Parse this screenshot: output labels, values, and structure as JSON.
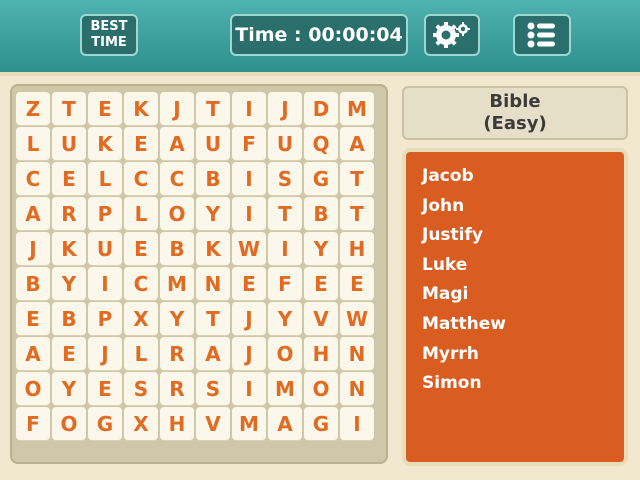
{
  "header": {
    "best_time_line1": "BEST",
    "best_time_line2": "TIME",
    "timer_text": "Time : 00:00:04",
    "settings_icon": "gear-icon",
    "menu_icon": "list-icon"
  },
  "colors": {
    "teal": "#2f8f8c",
    "orange": "#d95d21",
    "letter": "#e06b22"
  },
  "puzzle": {
    "category": "Bible",
    "difficulty": "(Easy)",
    "grid": [
      [
        "Z",
        "T",
        "E",
        "K",
        "J",
        "T",
        "I",
        "J",
        "D",
        "M"
      ],
      [
        "L",
        "U",
        "K",
        "E",
        "A",
        "U",
        "F",
        "U",
        "Q",
        "A"
      ],
      [
        "C",
        "E",
        "L",
        "C",
        "C",
        "B",
        "I",
        "S",
        "G",
        "T"
      ],
      [
        "A",
        "R",
        "P",
        "L",
        "O",
        "Y",
        "I",
        "T",
        "B",
        "T"
      ],
      [
        "J",
        "K",
        "U",
        "E",
        "B",
        "K",
        "W",
        "I",
        "Y",
        "H"
      ],
      [
        "B",
        "Y",
        "I",
        "C",
        "M",
        "N",
        "E",
        "F",
        "E",
        "E"
      ],
      [
        "E",
        "B",
        "P",
        "X",
        "Y",
        "T",
        "J",
        "Y",
        "V",
        "W"
      ],
      [
        "A",
        "E",
        "J",
        "L",
        "R",
        "A",
        "J",
        "O",
        "H",
        "N"
      ],
      [
        "O",
        "Y",
        "E",
        "S",
        "R",
        "S",
        "I",
        "M",
        "O",
        "N"
      ],
      [
        "F",
        "O",
        "G",
        "X",
        "H",
        "V",
        "M",
        "A",
        "G",
        "I"
      ]
    ],
    "words": [
      "Jacob",
      "John",
      "Justify",
      "Luke",
      "Magi",
      "Matthew",
      "Myrrh",
      "Simon"
    ]
  }
}
